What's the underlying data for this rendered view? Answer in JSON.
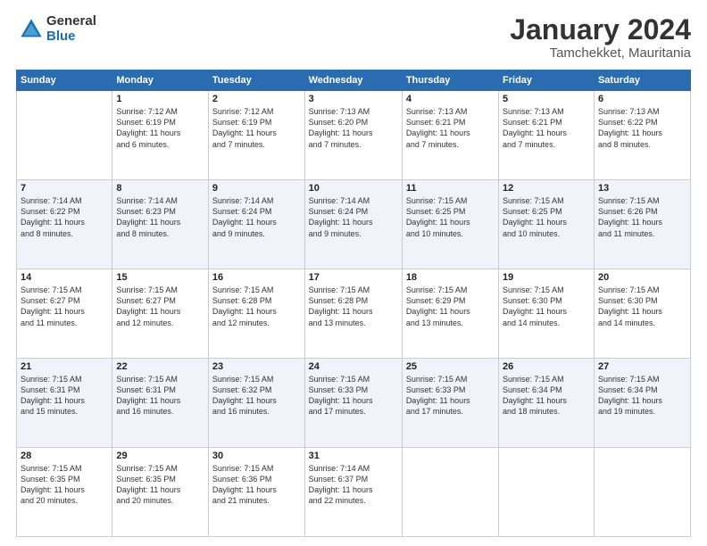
{
  "logo": {
    "general": "General",
    "blue": "Blue"
  },
  "title": "January 2024",
  "location": "Tamchekket, Mauritania",
  "days": [
    "Sunday",
    "Monday",
    "Tuesday",
    "Wednesday",
    "Thursday",
    "Friday",
    "Saturday"
  ],
  "weeks": [
    [
      {
        "num": "",
        "text": ""
      },
      {
        "num": "1",
        "text": "Sunrise: 7:12 AM\nSunset: 6:19 PM\nDaylight: 11 hours\nand 6 minutes."
      },
      {
        "num": "2",
        "text": "Sunrise: 7:12 AM\nSunset: 6:19 PM\nDaylight: 11 hours\nand 7 minutes."
      },
      {
        "num": "3",
        "text": "Sunrise: 7:13 AM\nSunset: 6:20 PM\nDaylight: 11 hours\nand 7 minutes."
      },
      {
        "num": "4",
        "text": "Sunrise: 7:13 AM\nSunset: 6:21 PM\nDaylight: 11 hours\nand 7 minutes."
      },
      {
        "num": "5",
        "text": "Sunrise: 7:13 AM\nSunset: 6:21 PM\nDaylight: 11 hours\nand 7 minutes."
      },
      {
        "num": "6",
        "text": "Sunrise: 7:13 AM\nSunset: 6:22 PM\nDaylight: 11 hours\nand 8 minutes."
      }
    ],
    [
      {
        "num": "7",
        "text": "Sunrise: 7:14 AM\nSunset: 6:22 PM\nDaylight: 11 hours\nand 8 minutes."
      },
      {
        "num": "8",
        "text": "Sunrise: 7:14 AM\nSunset: 6:23 PM\nDaylight: 11 hours\nand 8 minutes."
      },
      {
        "num": "9",
        "text": "Sunrise: 7:14 AM\nSunset: 6:24 PM\nDaylight: 11 hours\nand 9 minutes."
      },
      {
        "num": "10",
        "text": "Sunrise: 7:14 AM\nSunset: 6:24 PM\nDaylight: 11 hours\nand 9 minutes."
      },
      {
        "num": "11",
        "text": "Sunrise: 7:15 AM\nSunset: 6:25 PM\nDaylight: 11 hours\nand 10 minutes."
      },
      {
        "num": "12",
        "text": "Sunrise: 7:15 AM\nSunset: 6:25 PM\nDaylight: 11 hours\nand 10 minutes."
      },
      {
        "num": "13",
        "text": "Sunrise: 7:15 AM\nSunset: 6:26 PM\nDaylight: 11 hours\nand 11 minutes."
      }
    ],
    [
      {
        "num": "14",
        "text": "Sunrise: 7:15 AM\nSunset: 6:27 PM\nDaylight: 11 hours\nand 11 minutes."
      },
      {
        "num": "15",
        "text": "Sunrise: 7:15 AM\nSunset: 6:27 PM\nDaylight: 11 hours\nand 12 minutes."
      },
      {
        "num": "16",
        "text": "Sunrise: 7:15 AM\nSunset: 6:28 PM\nDaylight: 11 hours\nand 12 minutes."
      },
      {
        "num": "17",
        "text": "Sunrise: 7:15 AM\nSunset: 6:28 PM\nDaylight: 11 hours\nand 13 minutes."
      },
      {
        "num": "18",
        "text": "Sunrise: 7:15 AM\nSunset: 6:29 PM\nDaylight: 11 hours\nand 13 minutes."
      },
      {
        "num": "19",
        "text": "Sunrise: 7:15 AM\nSunset: 6:30 PM\nDaylight: 11 hours\nand 14 minutes."
      },
      {
        "num": "20",
        "text": "Sunrise: 7:15 AM\nSunset: 6:30 PM\nDaylight: 11 hours\nand 14 minutes."
      }
    ],
    [
      {
        "num": "21",
        "text": "Sunrise: 7:15 AM\nSunset: 6:31 PM\nDaylight: 11 hours\nand 15 minutes."
      },
      {
        "num": "22",
        "text": "Sunrise: 7:15 AM\nSunset: 6:31 PM\nDaylight: 11 hours\nand 16 minutes."
      },
      {
        "num": "23",
        "text": "Sunrise: 7:15 AM\nSunset: 6:32 PM\nDaylight: 11 hours\nand 16 minutes."
      },
      {
        "num": "24",
        "text": "Sunrise: 7:15 AM\nSunset: 6:33 PM\nDaylight: 11 hours\nand 17 minutes."
      },
      {
        "num": "25",
        "text": "Sunrise: 7:15 AM\nSunset: 6:33 PM\nDaylight: 11 hours\nand 17 minutes."
      },
      {
        "num": "26",
        "text": "Sunrise: 7:15 AM\nSunset: 6:34 PM\nDaylight: 11 hours\nand 18 minutes."
      },
      {
        "num": "27",
        "text": "Sunrise: 7:15 AM\nSunset: 6:34 PM\nDaylight: 11 hours\nand 19 minutes."
      }
    ],
    [
      {
        "num": "28",
        "text": "Sunrise: 7:15 AM\nSunset: 6:35 PM\nDaylight: 11 hours\nand 20 minutes."
      },
      {
        "num": "29",
        "text": "Sunrise: 7:15 AM\nSunset: 6:35 PM\nDaylight: 11 hours\nand 20 minutes."
      },
      {
        "num": "30",
        "text": "Sunrise: 7:15 AM\nSunset: 6:36 PM\nDaylight: 11 hours\nand 21 minutes."
      },
      {
        "num": "31",
        "text": "Sunrise: 7:14 AM\nSunset: 6:37 PM\nDaylight: 11 hours\nand 22 minutes."
      },
      {
        "num": "",
        "text": ""
      },
      {
        "num": "",
        "text": ""
      },
      {
        "num": "",
        "text": ""
      }
    ]
  ]
}
